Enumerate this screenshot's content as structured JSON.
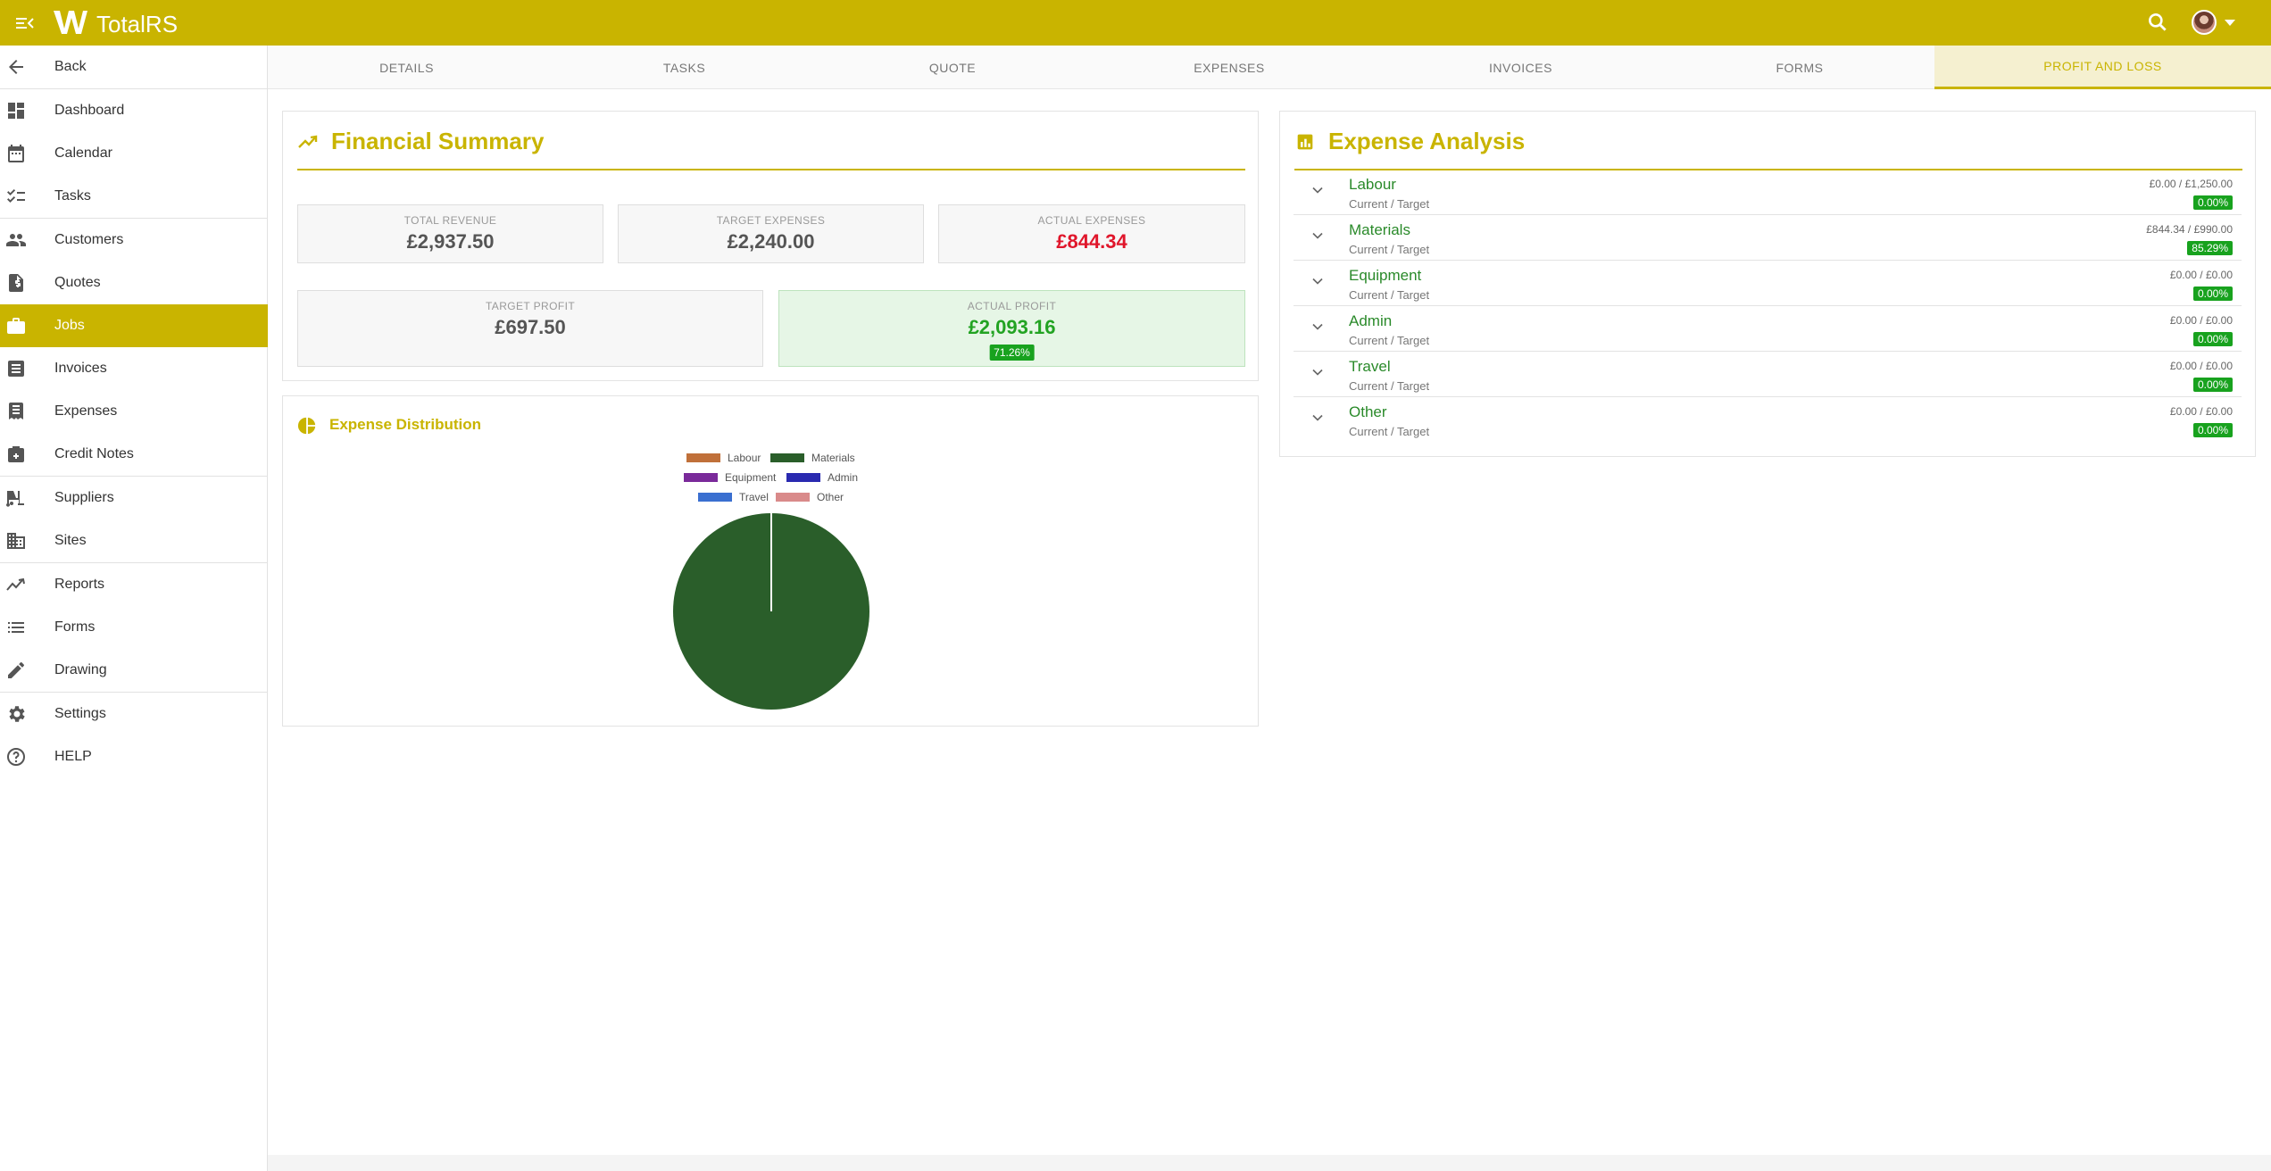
{
  "app": {
    "title": "TotalRS",
    "brand_color": "#c9b400"
  },
  "header": {
    "menu_icon": "menu-collapse-icon",
    "search_icon": "search-icon",
    "avatar": "user-avatar"
  },
  "sidebar": {
    "items": [
      {
        "label": "Back",
        "icon": "arrow-left-icon"
      },
      {
        "label": "Dashboard",
        "icon": "dashboard-icon"
      },
      {
        "label": "Calendar",
        "icon": "calendar-icon"
      },
      {
        "label": "Tasks",
        "icon": "checklist-icon"
      },
      {
        "label": "Customers",
        "icon": "people-icon"
      },
      {
        "label": "Quotes",
        "icon": "quote-document-icon"
      },
      {
        "label": "Jobs",
        "icon": "briefcase-icon",
        "active": true
      },
      {
        "label": "Invoices",
        "icon": "invoice-icon"
      },
      {
        "label": "Expenses",
        "icon": "receipt-icon"
      },
      {
        "label": "Credit Notes",
        "icon": "credit-note-icon"
      },
      {
        "label": "Suppliers",
        "icon": "forklift-icon"
      },
      {
        "label": "Sites",
        "icon": "building-icon"
      },
      {
        "label": "Reports",
        "icon": "trend-icon"
      },
      {
        "label": "Forms",
        "icon": "list-icon"
      },
      {
        "label": "Drawing",
        "icon": "draw-icon"
      },
      {
        "label": "Settings",
        "icon": "gear-icon"
      },
      {
        "label": "HELP",
        "icon": "help-circle-icon"
      }
    ]
  },
  "tabs": [
    {
      "label": "DETAILS"
    },
    {
      "label": "TASKS"
    },
    {
      "label": "QUOTE"
    },
    {
      "label": "EXPENSES"
    },
    {
      "label": "INVOICES"
    },
    {
      "label": "FORMS"
    },
    {
      "label": "PROFIT AND LOSS",
      "active": true
    }
  ],
  "financial_summary": {
    "title": "Financial Summary",
    "icon": "trending-up-icon",
    "total_revenue": {
      "label": "TOTAL REVENUE",
      "value": "£2,937.50"
    },
    "target_expenses": {
      "label": "TARGET EXPENSES",
      "value": "£2,240.00"
    },
    "actual_expenses": {
      "label": "ACTUAL EXPENSES",
      "value": "£844.34"
    },
    "target_profit": {
      "label": "TARGET PROFIT",
      "value": "£697.50"
    },
    "actual_profit": {
      "label": "ACTUAL PROFIT",
      "value": "£2,093.16",
      "percent": "71.26%"
    }
  },
  "expense_distribution": {
    "title": "Expense Distribution",
    "icon": "pie-chart-icon"
  },
  "chart_data": {
    "type": "pie",
    "categories": [
      "Labour",
      "Materials",
      "Equipment",
      "Admin",
      "Travel",
      "Other"
    ],
    "values": [
      0,
      844.34,
      0,
      0,
      0,
      0
    ],
    "colors": [
      "#c0703a",
      "#2a5e2a",
      "#7a2a9a",
      "#2a2ab0",
      "#3a6fd0",
      "#d98a8a"
    ],
    "legend": "top"
  },
  "expense_analysis": {
    "title": "Expense Analysis",
    "icon": "bar-chart-icon",
    "rows": [
      {
        "name": "Labour",
        "sub": "Current / Target",
        "current": "£0.00 /",
        "target": "£1,250.00",
        "percent": "0.00%"
      },
      {
        "name": "Materials",
        "sub": "Current / Target",
        "current": "£844.34 /",
        "target": "£990.00",
        "percent": "85.29%"
      },
      {
        "name": "Equipment",
        "sub": "Current / Target",
        "current": "£0.00 /",
        "target": "£0.00",
        "percent": "0.00%"
      },
      {
        "name": "Admin",
        "sub": "Current / Target",
        "current": "£0.00 /",
        "target": "£0.00",
        "percent": "0.00%"
      },
      {
        "name": "Travel",
        "sub": "Current / Target",
        "current": "£0.00 /",
        "target": "£0.00",
        "percent": "0.00%"
      },
      {
        "name": "Other",
        "sub": "Current / Target",
        "current": "£0.00 /",
        "target": "£0.00",
        "percent": "0.00%"
      }
    ]
  }
}
